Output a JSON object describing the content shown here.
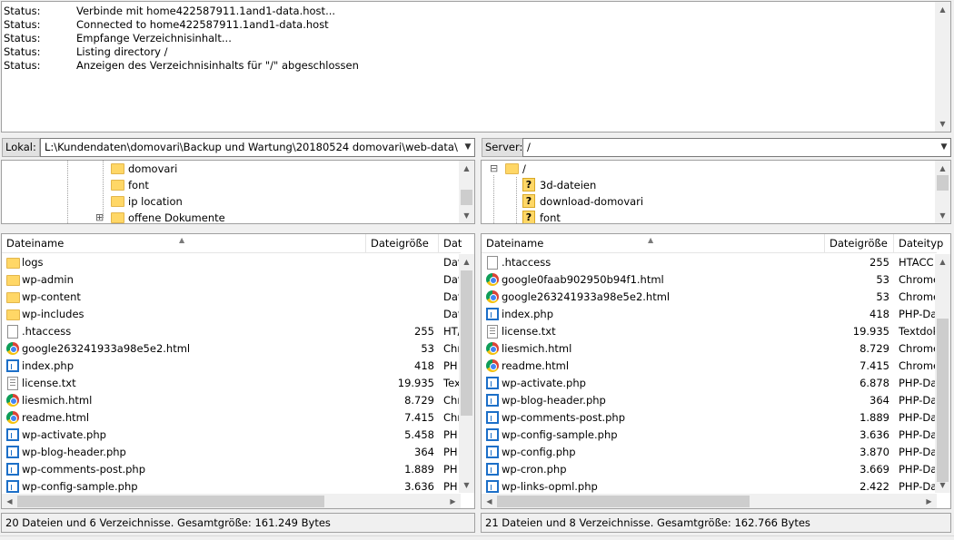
{
  "log": {
    "entries": [
      {
        "label": "Status:",
        "text": "Verbinde mit home422587911.1and1-data.host..."
      },
      {
        "label": "Status:",
        "text": "Connected to home422587911.1and1-data.host"
      },
      {
        "label": "Status:",
        "text": "Empfange Verzeichnisinhalt..."
      },
      {
        "label": "Status:",
        "text": "Listing directory /"
      },
      {
        "label": "Status:",
        "text": "Anzeigen des Verzeichnisinhalts für \"/\" abgeschlossen"
      }
    ]
  },
  "local": {
    "path_label": "Lokal:",
    "path_value": "L:\\Kundendaten\\domovari\\Backup und Wartung\\20180524 domovari\\web-data\\",
    "tree": [
      {
        "name": "domovari",
        "icon": "folder-icon"
      },
      {
        "name": "font",
        "icon": "folder-icon"
      },
      {
        "name": "ip location",
        "icon": "folder-icon"
      },
      {
        "name": "offene Dokumente",
        "icon": "folder-icon",
        "expander": "⊞"
      }
    ],
    "columns": {
      "name": "Dateiname",
      "size": "Dateigröße",
      "type": "Dat"
    },
    "files": [
      {
        "name": "logs",
        "size": "",
        "type": "Dat",
        "icon": "folder"
      },
      {
        "name": "wp-admin",
        "size": "",
        "type": "Dat",
        "icon": "folder"
      },
      {
        "name": "wp-content",
        "size": "",
        "type": "Dat",
        "icon": "folder"
      },
      {
        "name": "wp-includes",
        "size": "",
        "type": "Dat",
        "icon": "folder"
      },
      {
        "name": ".htaccess",
        "size": "255",
        "type": "HT/",
        "icon": "file"
      },
      {
        "name": "google263241933a98e5e2.html",
        "size": "53",
        "type": "Chr",
        "icon": "chrome"
      },
      {
        "name": "index.php",
        "size": "418",
        "type": "PH",
        "icon": "php"
      },
      {
        "name": "license.txt",
        "size": "19.935",
        "type": "Tex",
        "icon": "text"
      },
      {
        "name": "liesmich.html",
        "size": "8.729",
        "type": "Chr",
        "icon": "chrome"
      },
      {
        "name": "readme.html",
        "size": "7.415",
        "type": "Chr",
        "icon": "chrome"
      },
      {
        "name": "wp-activate.php",
        "size": "5.458",
        "type": "PH",
        "icon": "php"
      },
      {
        "name": "wp-blog-header.php",
        "size": "364",
        "type": "PH",
        "icon": "php"
      },
      {
        "name": "wp-comments-post.php",
        "size": "1.889",
        "type": "PH",
        "icon": "php"
      },
      {
        "name": "wp-config-sample.php",
        "size": "3.636",
        "type": "PH",
        "icon": "php"
      }
    ],
    "status": "20 Dateien und 6 Verzeichnisse. Gesamtgröße: 161.249 Bytes"
  },
  "remote": {
    "path_label": "Server:",
    "path_value": "/",
    "tree": [
      {
        "name": "/",
        "icon": "folder-icon",
        "expander": "⊟"
      },
      {
        "name": "3d-dateien",
        "icon": "unknown-folder-icon"
      },
      {
        "name": "download-domovari",
        "icon": "unknown-folder-icon"
      },
      {
        "name": "font",
        "icon": "unknown-folder-icon"
      }
    ],
    "columns": {
      "name": "Dateiname",
      "size": "Dateigröße",
      "type": "Dateityp"
    },
    "files": [
      {
        "name": ".htaccess",
        "size": "255",
        "type": "HTACC",
        "icon": "file"
      },
      {
        "name": "google0faab902950b94f1.html",
        "size": "53",
        "type": "Chrome",
        "icon": "chrome"
      },
      {
        "name": "google263241933a98e5e2.html",
        "size": "53",
        "type": "Chrome",
        "icon": "chrome"
      },
      {
        "name": "index.php",
        "size": "418",
        "type": "PHP-Da",
        "icon": "php"
      },
      {
        "name": "license.txt",
        "size": "19.935",
        "type": "Textdok",
        "icon": "text"
      },
      {
        "name": "liesmich.html",
        "size": "8.729",
        "type": "Chrome",
        "icon": "chrome"
      },
      {
        "name": "readme.html",
        "size": "7.415",
        "type": "Chrome",
        "icon": "chrome"
      },
      {
        "name": "wp-activate.php",
        "size": "6.878",
        "type": "PHP-Da",
        "icon": "php"
      },
      {
        "name": "wp-blog-header.php",
        "size": "364",
        "type": "PHP-Da",
        "icon": "php"
      },
      {
        "name": "wp-comments-post.php",
        "size": "1.889",
        "type": "PHP-Da",
        "icon": "php"
      },
      {
        "name": "wp-config-sample.php",
        "size": "3.636",
        "type": "PHP-Da",
        "icon": "php"
      },
      {
        "name": "wp-config.php",
        "size": "3.870",
        "type": "PHP-Da",
        "icon": "php"
      },
      {
        "name": "wp-cron.php",
        "size": "3.669",
        "type": "PHP-Da",
        "icon": "php"
      },
      {
        "name": "wp-links-opml.php",
        "size": "2.422",
        "type": "PHP-Da",
        "icon": "php"
      }
    ],
    "status": "21 Dateien und 8 Verzeichnisse. Gesamtgröße: 162.766 Bytes"
  },
  "colors": {
    "folder": "#ffd766",
    "php": "#1c6fc8",
    "scroll_thumb": "#cdcdcd"
  }
}
